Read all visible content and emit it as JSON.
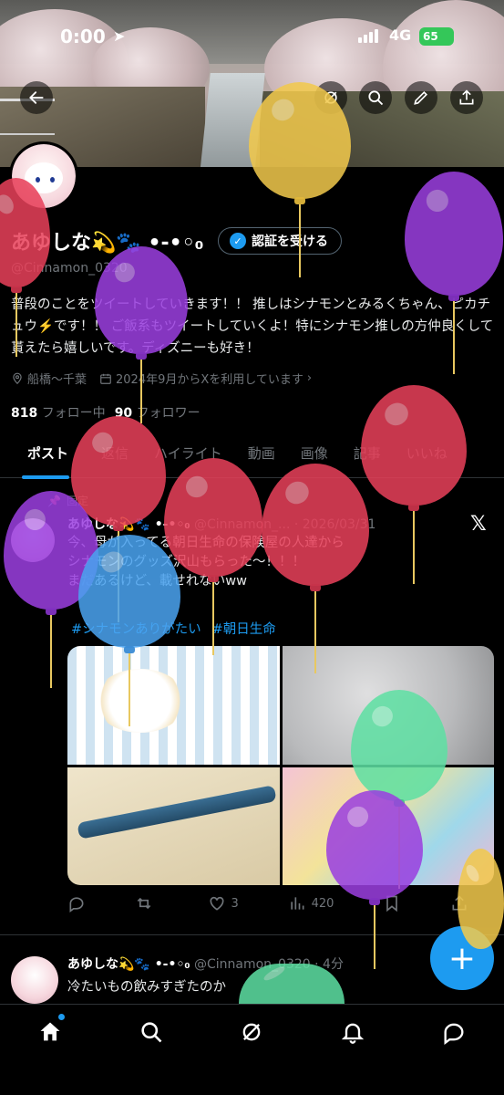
{
  "status_bar": {
    "time": "0:00",
    "network": "4G",
    "battery": "65"
  },
  "profile": {
    "name": "あゆしな💫🐾 •-•◦₀",
    "verify_label": "認証を受ける",
    "handle": "@Cinnamon_0320",
    "bio": "普段のことをツイートしていきます！！ 推しはシナモンとみるくちゃん、ピカチュウ⚡️です！！ ご飯系もツイートしていくよ！特にシナモン推しの方仲良くして貰えたら嬉しいです。ディズニーも好き！",
    "location": "船橋〜千葉",
    "joined": "2024年9月からXを利用しています",
    "following_count": "818",
    "following_label": "フォロー中",
    "followers_count": "90",
    "followers_label": "フォロワー"
  },
  "tabs": [
    {
      "label": "ポスト",
      "active": true
    },
    {
      "label": "返信",
      "active": false
    },
    {
      "label": "ハイライト",
      "active": false
    },
    {
      "label": "動画",
      "active": false
    },
    {
      "label": "画像",
      "active": false
    },
    {
      "label": "記事",
      "active": false
    },
    {
      "label": "いいね",
      "active": false
    }
  ],
  "post1": {
    "pinned_label": "固定",
    "name": "あゆしな💫🐾 •-•◦₀",
    "handle_date": "@Cinnamon_... · 2026/03/31",
    "text": "今、母が入ってる朝日生命の保険屋の人達から\nシナモンのグッズ沢山もらった〜！！！\nまだあるけど、載せれないww",
    "hashtags": [
      "#シナモンありがたい",
      "#朝日生命"
    ],
    "retweets": "",
    "likes": "3",
    "views": "420"
  },
  "post2": {
    "name": "あゆしな💫🐾 •-•◦₀",
    "handle_time": "@Cinnamon_0320 · 4分",
    "text": "冷たいもの飲みすぎたのか"
  },
  "icons": {
    "back": "back-arrow-icon",
    "search": "search-icon",
    "edit": "pen-icon",
    "share": "share-icon",
    "location": "location-pin-icon",
    "calendar": "calendar-icon",
    "verified": "verified-badge-icon",
    "x_logo": "x-logo-icon",
    "fab": "compose-plus-icon"
  },
  "colors": {
    "accent": "#1d9bf0",
    "background": "#000000",
    "text": "#e7e9ea",
    "muted": "#71767b",
    "balloon_red": "#e8405a",
    "balloon_purple": "#9b3fe0",
    "balloon_yellow": "#f2c94c",
    "balloon_blue": "#4aa3f0",
    "balloon_green": "#5ee0a3"
  }
}
